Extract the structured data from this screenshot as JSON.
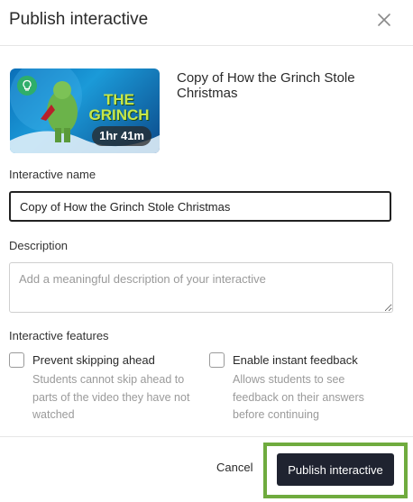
{
  "dialog": {
    "title": "Publish interactive",
    "close_icon": "close-icon"
  },
  "video": {
    "title": "Copy of How the Grinch Stole Christmas",
    "duration": "1hr 41m",
    "badge_icon": "lightbulb-icon",
    "thumbnail_text": "THE GRINCH"
  },
  "form": {
    "name_label": "Interactive name",
    "name_value": "Copy of How the Grinch Stole Christmas",
    "description_label": "Description",
    "description_placeholder": "Add a meaningful description of your interactive",
    "features_label": "Interactive features"
  },
  "features": [
    {
      "title": "Prevent skipping ahead",
      "description": "Students cannot skip ahead to parts of the video they have not watched",
      "checked": false
    },
    {
      "title": "Enable instant feedback",
      "description": "Allows students to see feedback on their answers before continuing",
      "checked": false
    }
  ],
  "footer": {
    "cancel_label": "Cancel",
    "publish_label": "Publish interactive"
  },
  "colors": {
    "primary_button": "#1f2330",
    "highlight": "#6fab3e",
    "badge": "#2fae6a"
  }
}
